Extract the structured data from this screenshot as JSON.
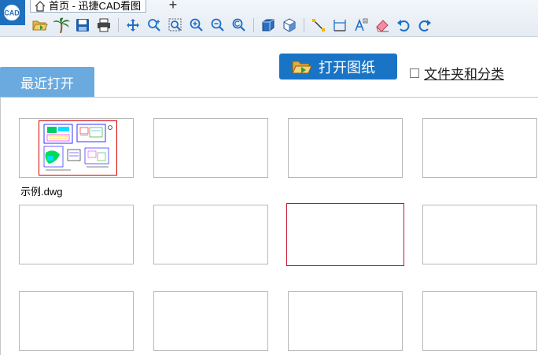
{
  "app": {
    "tab_title": "首页 - 迅捷CAD看图",
    "new_tab_symbol": "+",
    "logo_text": "CAD"
  },
  "toolbar": {
    "buttons": [
      {
        "id": "open-file",
        "icon": "folder-open-icon"
      },
      {
        "id": "palm",
        "icon": "palm-tree-icon"
      },
      {
        "id": "save",
        "icon": "save-icon"
      },
      {
        "id": "print",
        "icon": "print-icon"
      },
      {
        "id": "pan",
        "icon": "pan-arrows-icon"
      },
      {
        "id": "zoom-realtime",
        "icon": "zoom-realtime-icon"
      },
      {
        "id": "zoom-window",
        "icon": "zoom-window-icon"
      },
      {
        "id": "zoom-in",
        "icon": "zoom-in-icon"
      },
      {
        "id": "zoom-out",
        "icon": "zoom-out-icon"
      },
      {
        "id": "zoom-previous",
        "icon": "zoom-previous-icon"
      },
      {
        "id": "3d-box",
        "icon": "3d-box-icon"
      },
      {
        "id": "3d-orbit",
        "icon": "3d-orbit-icon"
      },
      {
        "id": "measure-line",
        "icon": "measure-line-icon"
      },
      {
        "id": "measure-dimension",
        "icon": "dimension-icon"
      },
      {
        "id": "text",
        "icon": "text-icon"
      },
      {
        "id": "eraser",
        "icon": "eraser-icon"
      },
      {
        "id": "undo",
        "icon": "undo-icon"
      },
      {
        "id": "redo",
        "icon": "redo-icon"
      }
    ]
  },
  "header": {
    "recent_tab": "最近打开",
    "open_button": "打开图纸",
    "folder_classify_label": "文件夹和分类",
    "folder_classify_checked": false
  },
  "files": {
    "items": [
      {
        "name": "示例.dwg",
        "has_preview": true
      }
    ]
  },
  "colors": {
    "accent_blue": "#1a74c6",
    "tab_blue": "#6aaadf",
    "hover_red": "#c8102e"
  }
}
